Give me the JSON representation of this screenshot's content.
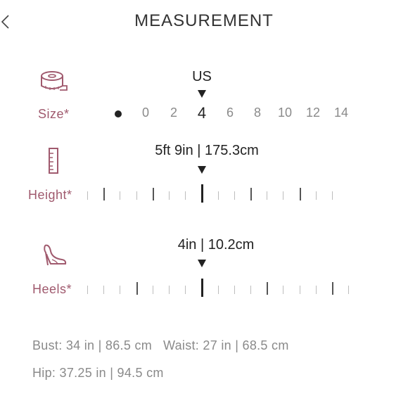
{
  "header": {
    "title": "MEASUREMENT",
    "back_icon": "chevron-left-icon"
  },
  "colors": {
    "accent": "#a05a6e",
    "text": "#222222",
    "muted": "#8a8a8a"
  },
  "size": {
    "label": "Size*",
    "icon": "tape-measure-icon",
    "unit": "US",
    "options": [
      "0",
      "2",
      "4",
      "6",
      "8",
      "10",
      "12",
      "14"
    ],
    "selected": "4"
  },
  "height": {
    "label": "Height*",
    "icon": "ruler-icon",
    "value": "5ft 9in | 175.3cm"
  },
  "heels": {
    "label": "Heels*",
    "icon": "high-heel-icon",
    "value": "4in | 10.2cm"
  },
  "measurements": {
    "bust": "Bust: 34 in | 86.5 cm",
    "waist": "Waist: 27 in | 68.5 cm",
    "hip": "Hip: 37.25 in | 94.5 cm"
  }
}
